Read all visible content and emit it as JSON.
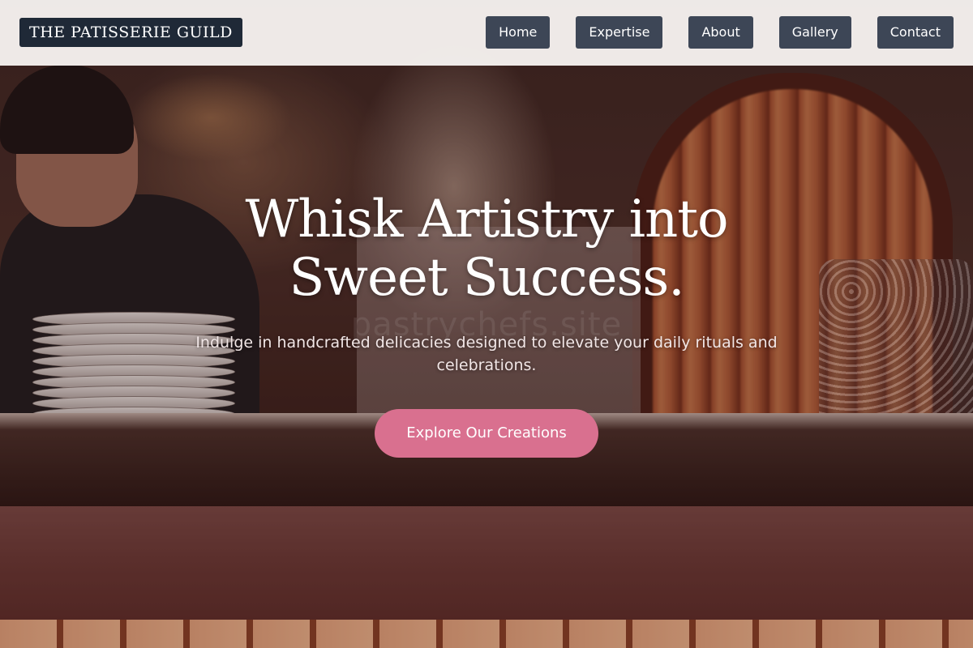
{
  "header": {
    "brand": "THE PATISSERIE GUILD",
    "nav": [
      {
        "label": "Home"
      },
      {
        "label": "Expertise"
      },
      {
        "label": "About"
      },
      {
        "label": "Gallery"
      },
      {
        "label": "Contact"
      }
    ]
  },
  "hero": {
    "title": "Whisk Artistry into Sweet Success.",
    "subtitle": "Indulge in handcrafted delicacies designed to elevate your daily rituals and celebrations.",
    "cta_label": "Explore Our Creations",
    "background_watermark": "pastrychefs.site"
  },
  "colors": {
    "brand_bg": "#1f2937",
    "nav_bg": "#3d4656",
    "cta_bg": "#d9708f",
    "header_bg": "#f8f4f2"
  }
}
